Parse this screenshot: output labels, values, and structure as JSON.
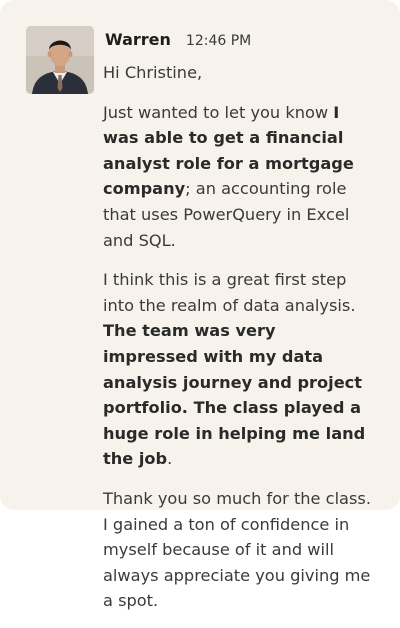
{
  "message": {
    "sender_name": "Warren",
    "timestamp": "12:46 PM",
    "avatar_icon": "user-photo",
    "greeting": "Hi Christine,",
    "paragraphs": [
      {
        "p1_a": "Just wanted to let you know ",
        "p1_b": "I was able to get a financial analyst role for a mortgage company",
        "p1_c": "; an accounting role that uses PowerQuery in Excel and SQL."
      },
      {
        "p2_a": "I think this is a great first step into the realm of data analysis. ",
        "p2_b": "The team was very impressed with my data analysis journey and project portfolio. The class played a huge role in helping me land the job",
        "p2_c": "."
      },
      {
        "p3_a": "Thank you so much for the class. I gained a ton of confidence in myself because of it and will always appreciate you giving me a spot."
      }
    ]
  },
  "colors": {
    "card_background": "#f7f3ec",
    "text": "#3a3a3a",
    "name_text": "#1e1e1e"
  }
}
